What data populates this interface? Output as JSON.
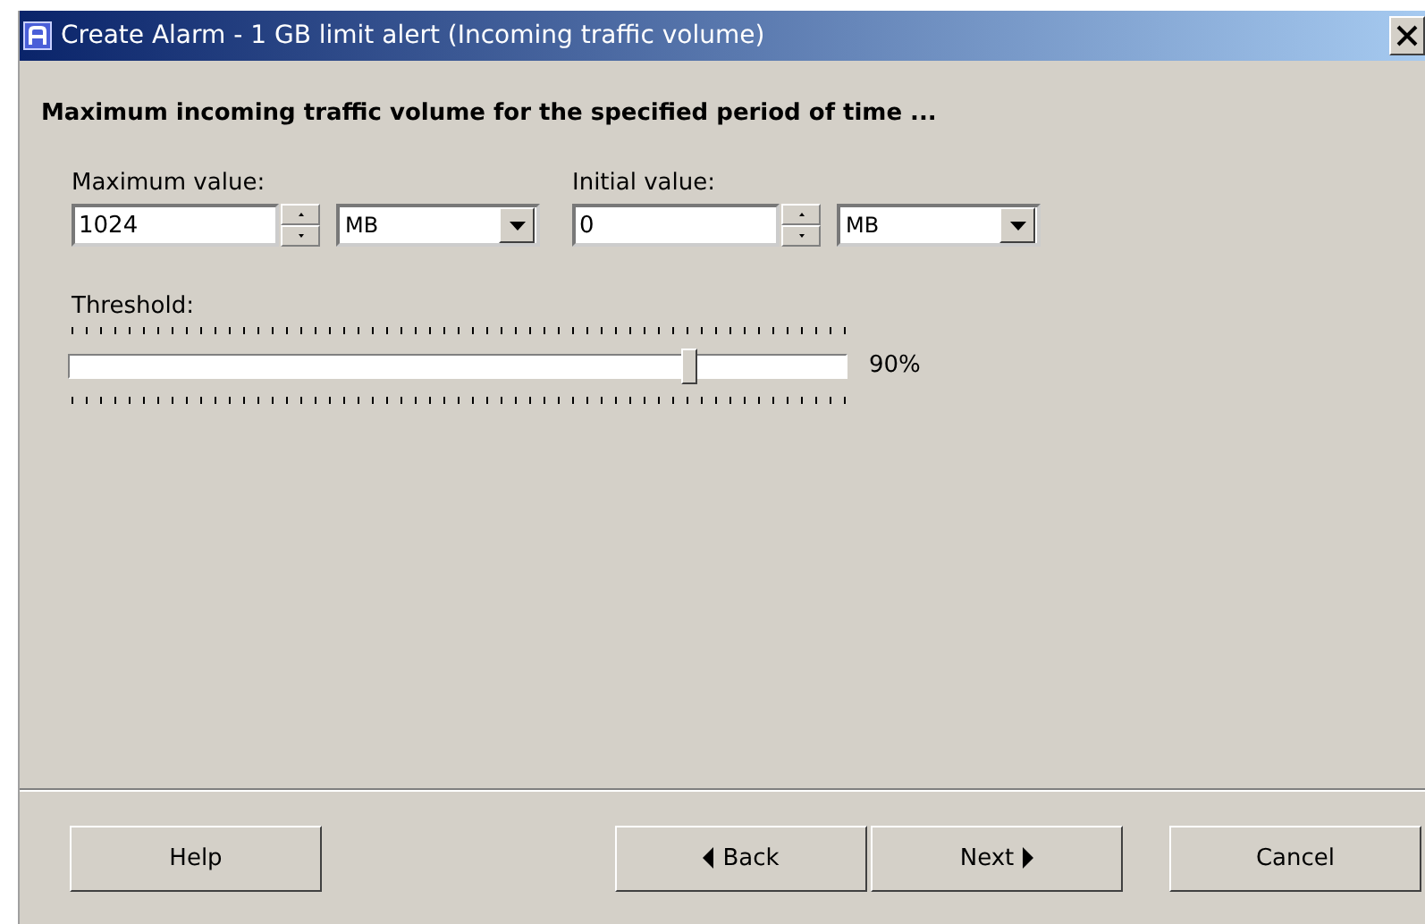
{
  "window": {
    "title": "Create Alarm - 1 GB limit alert (Incoming traffic volume)"
  },
  "heading": "Maximum incoming traffic volume for the specified period of time ...",
  "fields": [
    {
      "label": "Maximum value:",
      "value": "1024",
      "unit": "MB"
    },
    {
      "label": "Initial value:",
      "value": "0",
      "unit": "MB"
    }
  ],
  "threshold": {
    "label": "Threshold:",
    "level": 0.8,
    "reading": "90%"
  },
  "buttons": [
    {
      "label": "Help",
      "kind": "plain"
    },
    {
      "label": "Back",
      "kind": "back"
    },
    {
      "label": "Next",
      "kind": "next"
    },
    {
      "label": "Cancel",
      "kind": "plain"
    }
  ]
}
